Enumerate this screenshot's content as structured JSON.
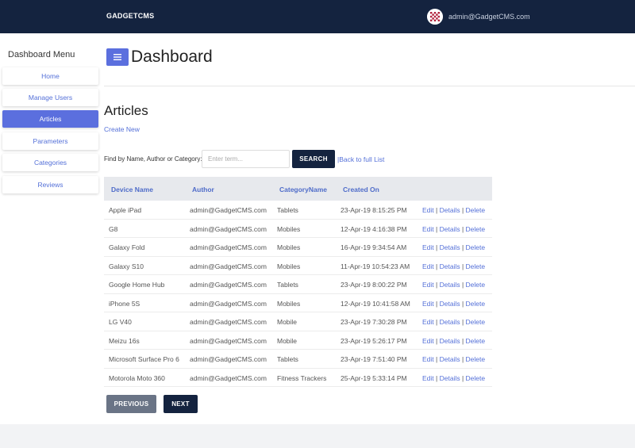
{
  "header": {
    "brand": "GADGETCMS",
    "user_email": "admin@GadgetCMS.com",
    "icon": "avatar-icon"
  },
  "sidebar": {
    "title": "Dashboard Menu",
    "items": [
      {
        "label": "Home",
        "active": false
      },
      {
        "label": "Manage Users",
        "active": false
      },
      {
        "label": "Articles",
        "active": true
      },
      {
        "label": "Parameters",
        "active": false
      },
      {
        "label": "Categories",
        "active": false
      },
      {
        "label": "Reviews",
        "active": false
      }
    ]
  },
  "main": {
    "menu_icon": "hamburger-icon",
    "page_title": "Dashboard",
    "section_title": "Articles",
    "create_new": "Create New",
    "search": {
      "label": "Find by Name, Author or Category:",
      "placeholder": "Enter term...",
      "button": "SEARCH",
      "back_link": "|Back to full List"
    },
    "table": {
      "headers": [
        "Device Name",
        "Author",
        "CategoryName",
        "Created On"
      ],
      "rows": [
        [
          "Apple iPad",
          "admin@GadgetCMS.com",
          "Tablets",
          "23-Apr-19 8:15:25 PM"
        ],
        [
          "G8",
          "admin@GadgetCMS.com",
          "Mobiles",
          "12-Apr-19 4:16:38 PM"
        ],
        [
          "Galaxy Fold",
          "admin@GadgetCMS.com",
          "Mobiles",
          "16-Apr-19 9:34:54 AM"
        ],
        [
          "Galaxy S10",
          "admin@GadgetCMS.com",
          "Mobiles",
          "11-Apr-19 10:54:23 AM"
        ],
        [
          "Google Home Hub",
          "admin@GadgetCMS.com",
          "Tablets",
          "23-Apr-19 8:00:22 PM"
        ],
        [
          "iPhone 5S",
          "admin@GadgetCMS.com",
          "Mobiles",
          "12-Apr-19 10:41:58 AM"
        ],
        [
          "LG V40",
          "admin@GadgetCMS.com",
          "Mobile",
          "23-Apr-19 7:30:28 PM"
        ],
        [
          "Meizu 16s",
          "admin@GadgetCMS.com",
          "Mobile",
          "23-Apr-19 5:26:17 PM"
        ],
        [
          "Microsoft Surface Pro 6",
          "admin@GadgetCMS.com",
          "Tablets",
          "23-Apr-19 7:51:40 PM"
        ],
        [
          "Motorola Moto 360",
          "admin@GadgetCMS.com",
          "Fitness Trackers",
          "25-Apr-19 5:33:14 PM"
        ]
      ],
      "actions": {
        "edit": "Edit",
        "details": "Details",
        "delete": "Delete",
        "separator": " | "
      }
    },
    "pagination": {
      "previous": "PREVIOUS",
      "next": "NEXT"
    }
  },
  "colors": {
    "navbar": "#14233f",
    "accent": "#5b6fde",
    "link": "#5470d8",
    "table_header_bg": "#e7e9ed"
  }
}
